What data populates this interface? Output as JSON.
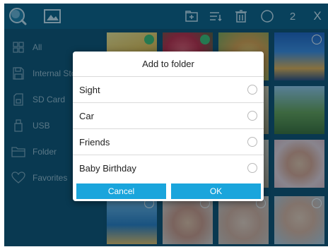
{
  "toolbar": {
    "selected_count": "2",
    "close_label": "X"
  },
  "sidebar": {
    "items": [
      {
        "label": "All",
        "icon": "grid-icon"
      },
      {
        "label": "Internal Storage",
        "icon": "save-icon"
      },
      {
        "label": "SD Card",
        "icon": "sd-card-icon"
      },
      {
        "label": "USB",
        "icon": "usb-icon"
      },
      {
        "label": "Folder",
        "icon": "folder-icon"
      },
      {
        "label": "Favorites",
        "icon": "heart-icon"
      }
    ]
  },
  "dialog": {
    "title": "Add to folder",
    "options": [
      {
        "label": "Sight",
        "selected": false
      },
      {
        "label": "Car",
        "selected": false
      },
      {
        "label": "Friends",
        "selected": false
      },
      {
        "label": "Baby Birthday",
        "selected": false
      }
    ],
    "cancel_label": "Cancel",
    "ok_label": "OK"
  },
  "colors": {
    "accent": "#1aa5dc",
    "topbar": "#0a5a7e",
    "sidebar": "#0b4c6a"
  }
}
